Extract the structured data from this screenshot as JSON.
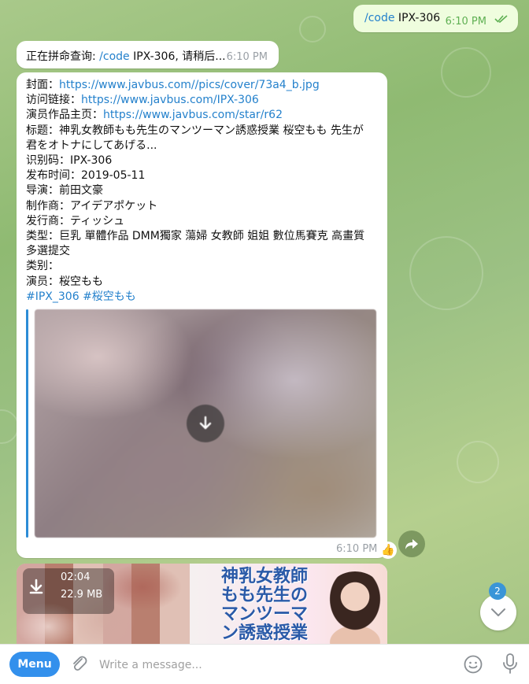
{
  "outgoing": {
    "command": "/code",
    "text": " IPX-306",
    "time": "6:10 PM"
  },
  "query": {
    "prefix": "正在拼命查询: ",
    "command": "/code",
    "suffix": " IPX-306, 请稍后...",
    "time": "6:10 PM"
  },
  "info": {
    "cover_label": "封面：",
    "cover_url": "https://www.javbus.com//pics/cover/73a4_b.jpg",
    "link_label": "访问链接：",
    "link_url": "https://www.javbus.com/IPX-306",
    "star_label": "演员作品主页：",
    "star_url": "https://www.javbus.com/star/r62",
    "title_line1": "标题：神乳女教師もも先生のマンツーマン誘惑授業 桜空もも 先生が",
    "title_line2": "君をオトナにしてあげる...",
    "code_line": "识别码：IPX-306",
    "date_line": "发布时间：2019-05-11",
    "director_line": "导演：前田文豪",
    "maker_line": "制作商：アイデアポケット",
    "publisher_line": "发行商：ティッシュ",
    "genre_line1": "类型：巨乳 單體作品 DMM獨家 蕩婦 女教師 姐姐 數位馬賽克 高畫質",
    "genre_line2": "多選提交",
    "category_line": "类别：",
    "actor_line": "演员：桜空もも",
    "hashtag1": "#IPX_306",
    "hashtag2": "#桜空もも",
    "time": "6:10 PM",
    "reaction": "👍"
  },
  "video": {
    "duration": "02:04",
    "size": "22.9 MB",
    "cover_title": "神乳女教師もも先生のマンツーマン誘惑授業"
  },
  "scroll": {
    "unread_count": "2"
  },
  "composer": {
    "menu_label": "Menu",
    "placeholder": "Write a message..."
  },
  "icons": {
    "double_check": "double-check-icon",
    "download": "download-icon",
    "forward": "forward-icon",
    "chevron": "chevron-down-icon",
    "attach": "paperclip-icon",
    "emoji": "emoji-icon",
    "mic": "microphone-icon"
  },
  "colors": {
    "accent": "#3390ec",
    "link": "#2481cc",
    "outgoing_bubble": "#effdde",
    "read_check": "#5fb053"
  }
}
